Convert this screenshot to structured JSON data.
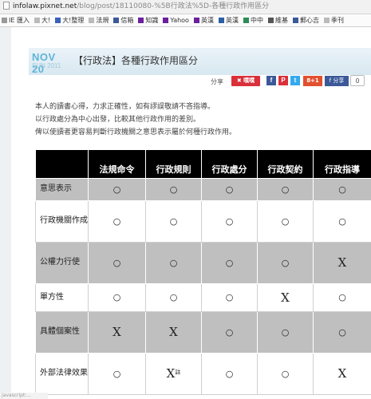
{
  "browser": {
    "url_domain": "infolaw.pixnet.net",
    "url_path": "/blog/post/18110080-%5B行政法%5D-各種行政作用區分",
    "bookmarks": [
      {
        "label": "IE 匯入",
        "icon": "folder-icon",
        "color": "#999999"
      },
      {
        "label": "大!",
        "icon": "page-icon",
        "color": "#bbbbbb"
      },
      {
        "label": "大!整理",
        "icon": "folder-icon",
        "color": "#3a62b8"
      },
      {
        "label": "法規",
        "icon": "page-icon",
        "color": "#bbbbbb"
      },
      {
        "label": "信箱",
        "icon": "mail-icon",
        "color": "#3b5998"
      },
      {
        "label": "知識",
        "icon": "yahoo-icon",
        "color": "#6b1f9d"
      },
      {
        "label": "Yahoo",
        "icon": "yahoo-icon",
        "color": "#6b1f9d"
      },
      {
        "label": "英漢",
        "icon": "yahoo-icon",
        "color": "#6b1f9d"
      },
      {
        "label": "英漢",
        "icon": "translate-icon",
        "color": "#2a5fa6"
      },
      {
        "label": "中中",
        "icon": "dictionary-icon",
        "color": "#2e8b57"
      },
      {
        "label": "維基",
        "icon": "wiki-icon",
        "color": "#555555"
      },
      {
        "label": "郵心吉",
        "icon": "facebook-icon",
        "color": "#3b5998"
      },
      {
        "label": "季刊",
        "icon": "page-icon",
        "color": "#bbbbbb"
      }
    ]
  },
  "post": {
    "date_month_day": "NOV 20",
    "date_weekday_year": "SUN 2011",
    "title": "【行政法】各種行政作用區分"
  },
  "share": {
    "label": "分享",
    "plurk_label": "噗噗",
    "facebook_icon_text": "f",
    "plurk_small_text": "P",
    "twitter_text": "t",
    "gplus_label": "8+1",
    "fb_share_label": "f 分享",
    "share_count": "0",
    "colors": {
      "plurk": "#d9303a",
      "facebook": "#3b5998",
      "twitter": "#33aaee",
      "gplus": "#e2512f"
    }
  },
  "intro": [
    "本人的讀書心得，力求正確性，如有謬誤敬請不吝指導。",
    "以行政處分為中心出發，比較其他行政作用的差別。",
    "俾以使讀者更容易判斷行政機關之意思表示屬於何種行政作用。"
  ],
  "table": {
    "headers": [
      "",
      "法規命令",
      "行政規則",
      "行政處分",
      "行政契約",
      "行政指導"
    ],
    "rows": [
      {
        "label": "意思表示",
        "shade": "gray",
        "cells": [
          "○",
          "○",
          "○",
          "○",
          "○"
        ]
      },
      {
        "label": "行政機關作成",
        "shade": "white",
        "cells": [
          "○",
          "○",
          "○",
          "○",
          "○"
        ]
      },
      {
        "label": "公權力行使",
        "shade": "gray",
        "cells": [
          "○",
          "○",
          "○",
          "○",
          "X"
        ]
      },
      {
        "label": "單方性",
        "shade": "white",
        "cells": [
          "○",
          "○",
          "○",
          "X",
          "○"
        ]
      },
      {
        "label": "具體個案性",
        "shade": "gray",
        "cells": [
          "X",
          "X",
          "○",
          "○",
          "○"
        ]
      },
      {
        "label": "外部法律效果",
        "shade": "white",
        "cells": [
          "○",
          "X",
          "○",
          "○",
          "X"
        ],
        "note_sup": "註"
      }
    ]
  },
  "status_text": "javascript:..."
}
